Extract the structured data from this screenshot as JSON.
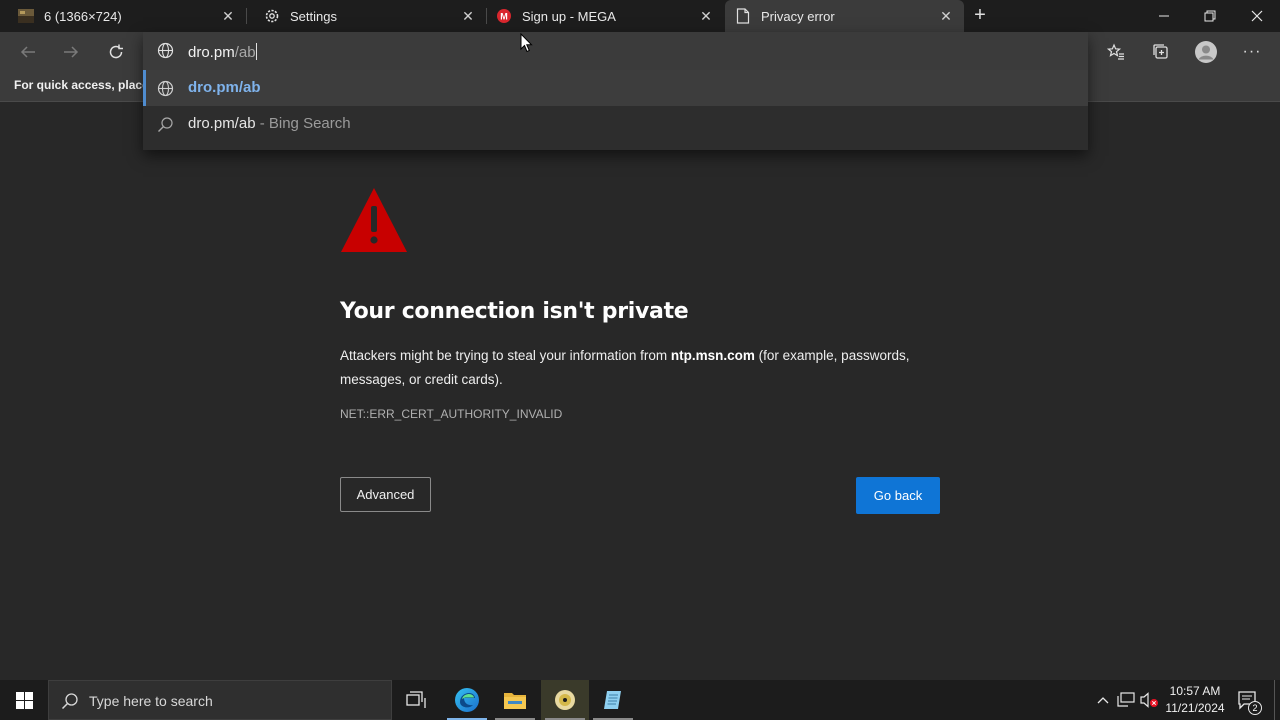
{
  "tabs": [
    {
      "title": "6 (1366×724)",
      "icon": "image-thumbnail-icon"
    },
    {
      "title": "Settings",
      "icon": "gear-icon"
    },
    {
      "title": "Sign up - MEGA",
      "icon": "mega-logo-icon"
    },
    {
      "title": "Privacy error",
      "icon": "document-icon",
      "active": true
    }
  ],
  "favorites_bar": {
    "text": "For quick access, place y"
  },
  "omnibox": {
    "typed": "dro.pm",
    "autocomplete_rest": "/ab",
    "suggestions": [
      {
        "text": "dro.pm/ab",
        "icon": "globe-icon",
        "selected": true
      },
      {
        "text": "dro.pm/ab",
        "suffix": " - Bing Search",
        "icon": "search-icon"
      }
    ]
  },
  "page": {
    "title": "Your connection isn't private",
    "desc_before": "Attackers might be trying to steal your information from ",
    "desc_host": "ntp.msn.com",
    "desc_after": " (for example, passwords, messages, or credit cards).",
    "error_code": "NET::ERR_CERT_AUTHORITY_INVALID",
    "advanced_label": "Advanced",
    "goback_label": "Go back"
  },
  "taskbar": {
    "search_placeholder": "Type here to search",
    "time": "10:57 AM",
    "date": "11/21/2024",
    "notification_count": "2"
  },
  "colors": {
    "accent_blue": "#0f75d6",
    "warning_red": "#c80000",
    "suggestion_link": "#7fb3ec"
  }
}
